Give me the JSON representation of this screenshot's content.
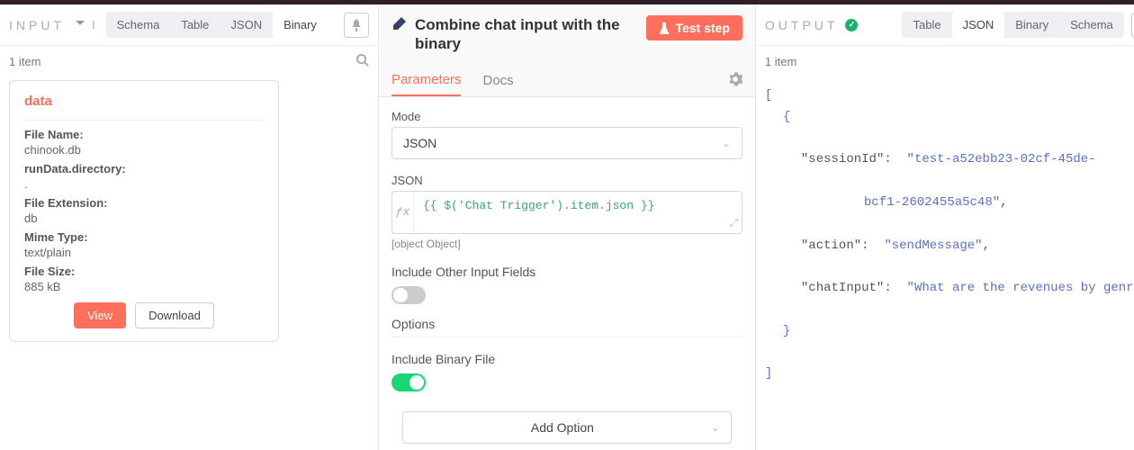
{
  "input": {
    "label": "INPUT",
    "tabs": [
      "Schema",
      "Table",
      "JSON",
      "Binary"
    ],
    "activeTab": "Binary",
    "itemCount": "1 item",
    "card": {
      "title": "data",
      "fields": {
        "fileName_label": "File Name:",
        "fileName": "chinook.db",
        "runData_label": "runData.directory:",
        "runData": ".",
        "fileExt_label": "File Extension:",
        "fileExt": "db",
        "mime_label": "Mime Type:",
        "mime": "text/plain",
        "size_label": "File Size:",
        "size": "885 kB"
      },
      "view_btn": "View",
      "download_btn": "Download"
    }
  },
  "center": {
    "title": "Combine chat input with the binary",
    "test_btn": "Test step",
    "tabs": {
      "parameters": "Parameters",
      "docs": "Docs"
    },
    "mode_label": "Mode",
    "mode_value": "JSON",
    "json_label": "JSON",
    "json_expr": "{{ $('Chat Trigger').item.json }}",
    "json_result": "[object Object]",
    "include_other_label": "Include Other Input Fields",
    "options_label": "Options",
    "include_binary_label": "Include Binary File",
    "add_option_label": "Add Option"
  },
  "output": {
    "label": "OUTPUT",
    "tabs": [
      "Table",
      "JSON",
      "Binary",
      "Schema"
    ],
    "activeTab": "JSON",
    "itemCount": "1 item",
    "json": {
      "sessionId_key": "\"sessionId\"",
      "sessionId_val1": "\"test-a52ebb23-02cf-45de-",
      "sessionId_val2": "bcf1-2602455a5c48\"",
      "action_key": "\"action\"",
      "action_val": "\"sendMessage\"",
      "chatInput_key": "\"chatInput\"",
      "chatInput_val": "\"What are the revenues by genre?\""
    }
  }
}
